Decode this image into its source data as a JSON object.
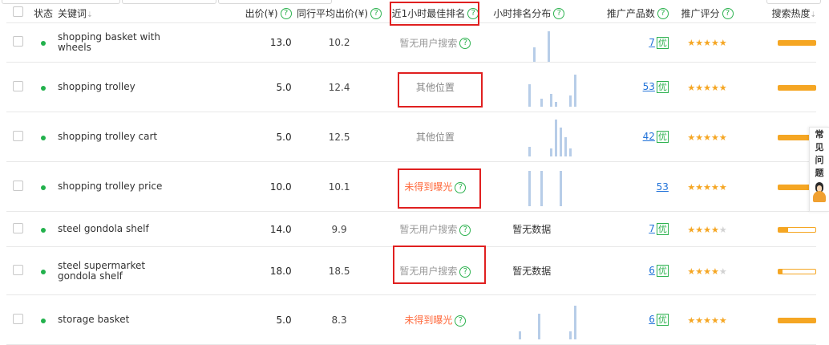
{
  "headers": {
    "status": "状态",
    "keyword": "关键词",
    "bid": "出价(¥)",
    "avg_bid": "同行平均出价(¥)",
    "best_rank": "近1小时最佳排名",
    "rank_dist": "小时排名分布",
    "product_count": "推广产品数",
    "score": "推广评分",
    "heat": "搜索热度"
  },
  "icons": {
    "help": "?",
    "sort": "⇣",
    "side_tab_avatar": "customer-service-avatar-icon"
  },
  "colors": {
    "status_active": "#22b14c",
    "help_green": "#2db24f",
    "link_blue": "#2273d9",
    "star": "#f5a623",
    "not_exposed": "#ff6a3d",
    "highlight_box": "#e02020"
  },
  "rows": [
    {
      "keyword": "shopping basket with wheels",
      "bid": "13.0",
      "avg": "10.2",
      "best": "暂无用户搜索",
      "best_kind": "none",
      "best_help": true,
      "dist": [
        0,
        0,
        0,
        0,
        0,
        0,
        0,
        0,
        0,
        0,
        0,
        0,
        0,
        0,
        0,
        0,
        0,
        0,
        0,
        0,
        0,
        0,
        0,
        0
      ],
      "dist_vals": [
        0,
        0,
        0,
        0,
        0,
        0,
        0,
        0,
        0,
        0,
        0,
        0,
        18,
        0,
        0,
        0,
        0,
        0,
        38,
        0,
        0,
        0,
        0,
        0
      ],
      "dist_text": "",
      "count": "7",
      "you": "优",
      "stars": 5,
      "heat": 1.0
    },
    {
      "keyword": "shopping trolley",
      "bid": "5.0",
      "avg": "12.4",
      "best": "其他位置",
      "best_kind": "other",
      "best_help": false,
      "dist_vals": [
        0,
        0,
        0,
        0,
        0,
        0,
        0,
        0,
        0,
        0,
        28,
        0,
        0,
        0,
        0,
        10,
        0,
        0,
        0,
        16,
        0,
        6,
        0,
        0,
        0,
        0,
        0,
        14,
        0,
        40
      ],
      "dist_text": "",
      "count": "53",
      "you": "优",
      "stars": 5,
      "heat": 1.0
    },
    {
      "keyword": "shopping trolley cart",
      "bid": "5.0",
      "avg": "12.5",
      "best": "其他位置",
      "best_kind": "other",
      "best_help": false,
      "dist_vals": [
        0,
        0,
        0,
        0,
        0,
        0,
        0,
        0,
        0,
        0,
        12,
        0,
        0,
        0,
        0,
        0,
        0,
        0,
        0,
        10,
        0,
        46,
        0,
        36,
        0,
        24,
        0,
        10,
        0,
        0
      ],
      "dist_text": "",
      "count": "42",
      "you": "优",
      "stars": 5,
      "heat": 1.0
    },
    {
      "keyword": "shopping trolley price",
      "bid": "10.0",
      "avg": "10.1",
      "best": "未得到曝光",
      "best_kind": "red",
      "best_help": true,
      "dist_vals": [
        0,
        0,
        0,
        0,
        0,
        0,
        0,
        0,
        0,
        0,
        44,
        0,
        0,
        0,
        0,
        44,
        0,
        0,
        0,
        0,
        0,
        0,
        0,
        44,
        0,
        0,
        0,
        0,
        0,
        0
      ],
      "dist_text": "",
      "count": "53",
      "you": "",
      "stars": 5,
      "heat": 0.9
    },
    {
      "keyword": "steel gondola shelf",
      "bid": "14.0",
      "avg": "9.9",
      "best": "暂无用户搜索",
      "best_kind": "none",
      "best_help": true,
      "dist_vals": [],
      "dist_text": "暂无数据",
      "count": "7",
      "you": "优",
      "stars": 4,
      "heat": 0.25
    },
    {
      "keyword": "steel supermarket gondola shelf",
      "bid": "18.0",
      "avg": "18.5",
      "best": "暂无用户搜索",
      "best_kind": "none",
      "best_help": true,
      "dist_vals": [],
      "dist_text": "暂无数据",
      "count": "6",
      "you": "优",
      "stars": 4,
      "heat": 0.1
    },
    {
      "keyword": "storage basket",
      "bid": "5.0",
      "avg": "8.3",
      "best": "未得到曝光",
      "best_kind": "red",
      "best_help": true,
      "dist_vals": [
        0,
        0,
        0,
        0,
        0,
        0,
        10,
        0,
        0,
        0,
        0,
        0,
        0,
        0,
        32,
        0,
        0,
        0,
        0,
        0,
        0,
        0,
        0,
        0,
        0,
        0,
        0,
        10,
        0,
        42
      ],
      "dist_text": "",
      "count": "6",
      "you": "优",
      "stars": 5,
      "heat": 1.0
    }
  ],
  "side_tab": {
    "chars": [
      "常",
      "见",
      "问",
      "题"
    ]
  }
}
